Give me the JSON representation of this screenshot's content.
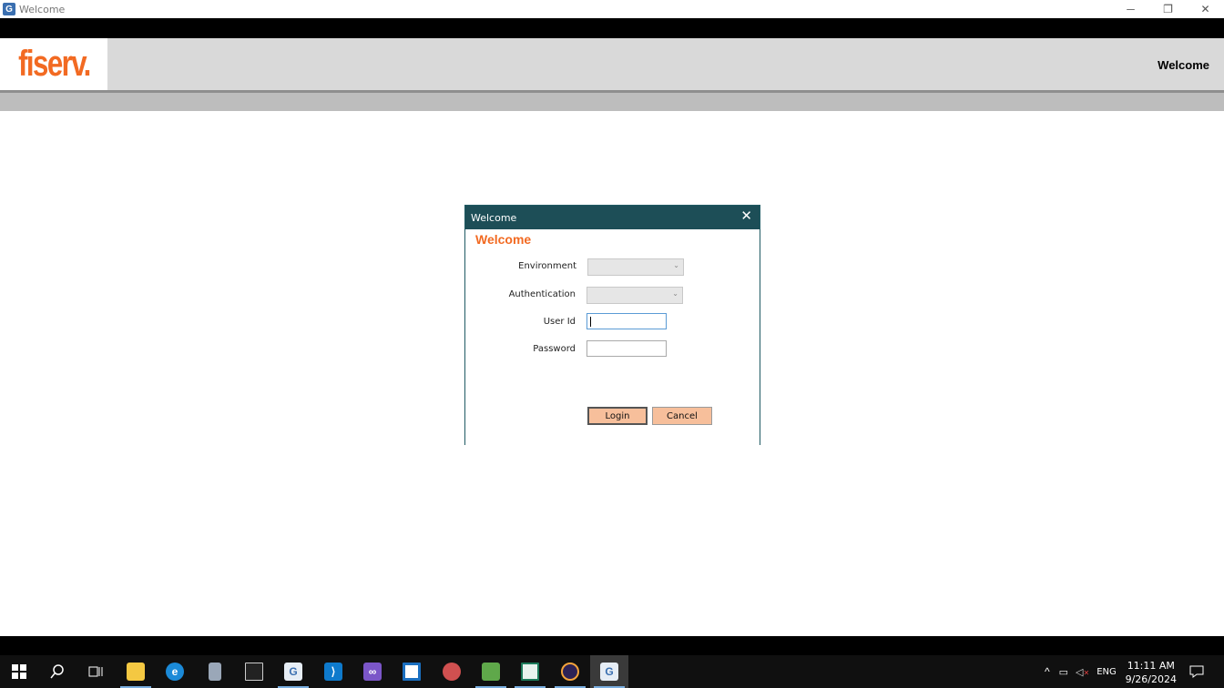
{
  "window": {
    "title": "Welcome",
    "minimize": "─",
    "restore": "❐",
    "close": "✕"
  },
  "header": {
    "logo": "fiserv.",
    "title": "Welcome"
  },
  "dialog": {
    "title": "Welcome",
    "close": "✕",
    "heading": "Welcome",
    "fields": {
      "environment_label": "Environment",
      "environment_value": "",
      "authentication_label": "Authentication",
      "authentication_value": "",
      "userid_label": "User Id",
      "userid_value": "",
      "password_label": "Password",
      "password_value": ""
    },
    "buttons": {
      "login": "Login",
      "cancel": "Cancel"
    }
  },
  "taskbar": {
    "apps": [
      {
        "name": "start-icon"
      },
      {
        "name": "search-icon"
      },
      {
        "name": "task-view-icon"
      },
      {
        "name": "file-explorer-icon"
      },
      {
        "name": "edge-icon"
      },
      {
        "name": "app-icon"
      },
      {
        "name": "terminal-icon"
      },
      {
        "name": "app-icon"
      },
      {
        "name": "vscode-icon"
      },
      {
        "name": "visual-studio-icon"
      },
      {
        "name": "app-icon"
      },
      {
        "name": "app-icon"
      },
      {
        "name": "notepad-icon"
      },
      {
        "name": "app-icon"
      },
      {
        "name": "eclipse-icon"
      },
      {
        "name": "welcome-app-icon"
      }
    ],
    "tray": {
      "language": "ENG",
      "time": "11:11 AM",
      "date": "9/26/2024"
    }
  },
  "colors": {
    "accent": "#f26a22",
    "dialog_title_bg": "#1d4e57",
    "button_bg": "#f7bf9b"
  }
}
